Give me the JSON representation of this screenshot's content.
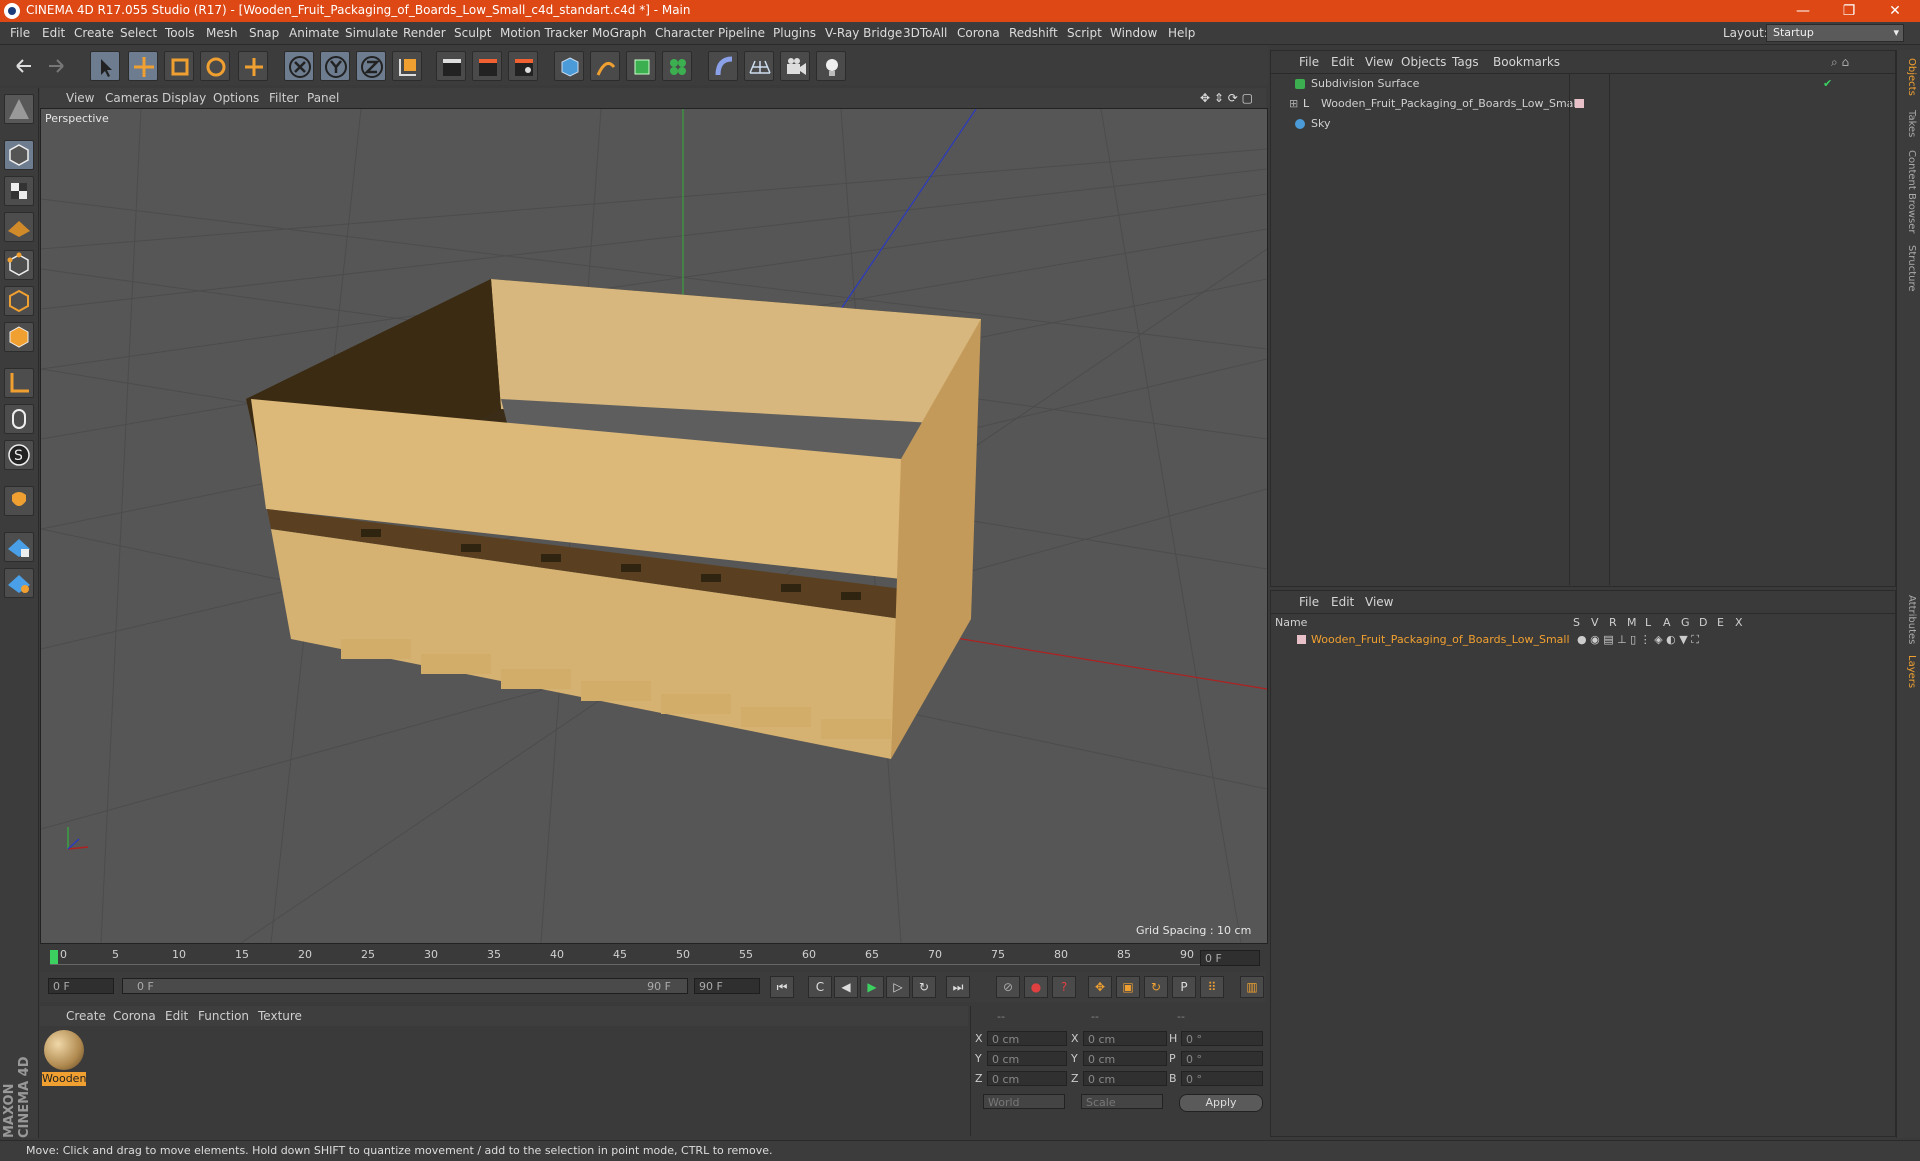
{
  "window": {
    "title": "CINEMA 4D R17.055 Studio (R17) - [Wooden_Fruit_Packaging_of_Boards_Low_Small_c4d_standart.c4d *] - Main",
    "controls": [
      "—",
      "❐",
      "✕"
    ]
  },
  "menubar": {
    "items": [
      "File",
      "Edit",
      "Create",
      "Select",
      "Tools",
      "Mesh",
      "Snap",
      "Animate",
      "Simulate",
      "Render",
      "Sculpt",
      "Motion Tracker",
      "MoGraph",
      "Character",
      "Pipeline",
      "Plugins",
      "V-Ray Bridge",
      "3DToAll",
      "Corona",
      "Redshift",
      "Script",
      "Window",
      "Help"
    ],
    "layout_label": "Layout:",
    "layout_value": "Startup"
  },
  "viewport": {
    "menu": [
      "View",
      "Cameras",
      "Display",
      "Options",
      "Filter",
      "Panel"
    ],
    "label": "Perspective",
    "grid_spacing": "Grid Spacing : 10 cm"
  },
  "timeline": {
    "ticks": [
      "0",
      "5",
      "10",
      "15",
      "20",
      "25",
      "30",
      "35",
      "40",
      "45",
      "50",
      "55",
      "60",
      "65",
      "70",
      "75",
      "80",
      "85",
      "90"
    ],
    "current_frame": "0 F",
    "start_field": "0 F",
    "range_start": "0 F",
    "range_end": "90 F",
    "end_field": "90 F"
  },
  "material_manager": {
    "menu": [
      "Create",
      "Corona",
      "Edit",
      "Function",
      "Texture"
    ],
    "materials": [
      {
        "name": "Wooden"
      }
    ]
  },
  "coordinates": {
    "header": [
      "--",
      "--",
      "--"
    ],
    "rows": [
      {
        "axis": "X",
        "pos": "0 cm",
        "axis2": "X",
        "size": "0 cm",
        "axis3": "H",
        "rot": "0 °"
      },
      {
        "axis": "Y",
        "pos": "0 cm",
        "axis2": "Y",
        "size": "0 cm",
        "axis3": "P",
        "rot": "0 °"
      },
      {
        "axis": "Z",
        "pos": "0 cm",
        "axis2": "Z",
        "size": "0 cm",
        "axis3": "B",
        "rot": "0 °"
      }
    ],
    "mode": "World",
    "transform": "Scale",
    "apply_label": "Apply"
  },
  "object_manager": {
    "menu": [
      "File",
      "Edit",
      "View",
      "Objects",
      "Tags",
      "Bookmarks"
    ],
    "objects": [
      {
        "name": "Subdivision Surface"
      },
      {
        "name": "Wooden_Fruit_Packaging_of_Boards_Low_Small"
      },
      {
        "name": "Sky"
      }
    ]
  },
  "layer_manager": {
    "menu": [
      "File",
      "Edit",
      "View"
    ],
    "columns": [
      "Name",
      "S",
      "V",
      "R",
      "M",
      "L",
      "A",
      "G",
      "D",
      "E",
      "X"
    ],
    "layers": [
      {
        "name": "Wooden_Fruit_Packaging_of_Boards_Low_Small"
      }
    ]
  },
  "right_tabs": [
    "Objects",
    "Takes",
    "Content Browser",
    "Structure",
    "Attributes",
    "Layers"
  ],
  "brand": "MAXON CINEMA 4D",
  "status": "Move: Click and drag to move elements. Hold down SHIFT to quantize movement / add to the selection in point mode, CTRL to remove.",
  "colors": {
    "title_bar": "#dd4814",
    "accent": "#f0a030",
    "wood": "#d8b47a"
  }
}
